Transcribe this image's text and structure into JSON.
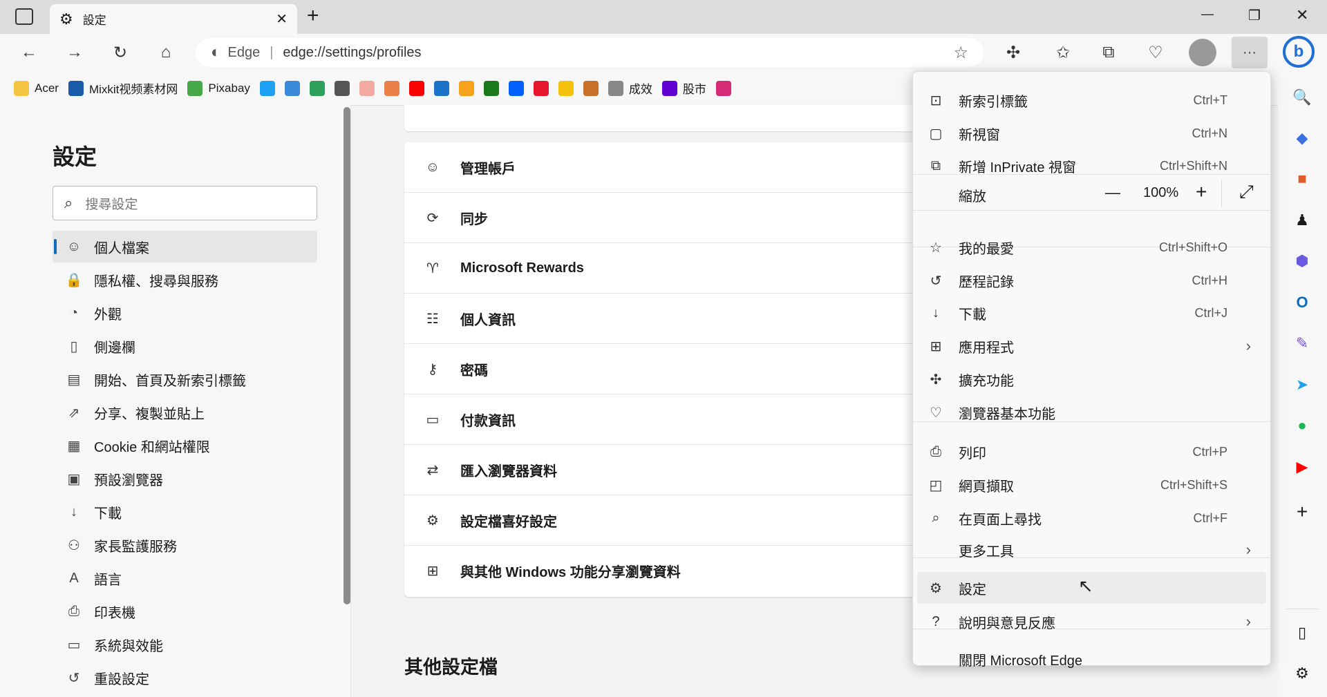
{
  "tab": {
    "title": "設定",
    "close": "✕",
    "new_tab": "+"
  },
  "window": {
    "minimize": "—",
    "restore": "❐",
    "close": "✕"
  },
  "address": {
    "brand": "Edge",
    "url": "edge://settings/profiles"
  },
  "bookmarks": [
    {
      "label": "Acer",
      "color": "#f5c542"
    },
    {
      "label": "Mixkit视频素材网",
      "color": "#1a5aa8"
    },
    {
      "label": "Pixabay",
      "color": "#48a948"
    },
    {
      "label": "",
      "color": "#1ea1f2"
    },
    {
      "label": "",
      "color": "#3b8ad9"
    },
    {
      "label": "",
      "color": "#2ea05a"
    },
    {
      "label": "",
      "color": "#555"
    },
    {
      "label": "",
      "color": "#f1a9a0"
    },
    {
      "label": "",
      "color": "#e9804a"
    },
    {
      "label": "",
      "color": "#ff0000"
    },
    {
      "label": "",
      "color": "#1a73c8"
    },
    {
      "label": "",
      "color": "#f7a21b"
    },
    {
      "label": "",
      "color": "#1a7a1a"
    },
    {
      "label": "",
      "color": "#0061fe"
    },
    {
      "label": "",
      "color": "#e6162d"
    },
    {
      "label": "",
      "color": "#f4c20d"
    },
    {
      "label": "",
      "color": "#c8702a"
    },
    {
      "label": "成效",
      "color": "#888"
    },
    {
      "label": "股市",
      "color": "#6001d2"
    },
    {
      "label": "",
      "color": "#d62976"
    }
  ],
  "settings": {
    "title": "設定",
    "search_placeholder": "搜尋設定",
    "nav": [
      {
        "label": "個人檔案",
        "icon": "profile-icon",
        "glyph": "☺",
        "selected": true
      },
      {
        "label": "隱私權、搜尋與服務",
        "icon": "lock-icon",
        "glyph": "🔒"
      },
      {
        "label": "外觀",
        "icon": "palette-icon",
        "glyph": "◔"
      },
      {
        "label": "側邊欄",
        "icon": "sidebar-icon",
        "glyph": "▯"
      },
      {
        "label": "開始、首頁及新索引標籤",
        "icon": "home-tab-icon",
        "glyph": "▤"
      },
      {
        "label": "分享、複製並貼上",
        "icon": "share-icon",
        "glyph": "⇗"
      },
      {
        "label": "Cookie 和網站權限",
        "icon": "site-permissions-icon",
        "glyph": "▦"
      },
      {
        "label": "預設瀏覽器",
        "icon": "default-browser-icon",
        "glyph": "▣"
      },
      {
        "label": "下載",
        "icon": "download-icon",
        "glyph": "↓"
      },
      {
        "label": "家長監護服務",
        "icon": "family-icon",
        "glyph": "⚇"
      },
      {
        "label": "語言",
        "icon": "language-icon",
        "glyph": "A"
      },
      {
        "label": "印表機",
        "icon": "printer-icon",
        "glyph": "⎙"
      },
      {
        "label": "系統與效能",
        "icon": "system-icon",
        "glyph": "▭"
      },
      {
        "label": "重設設定",
        "icon": "reset-icon",
        "glyph": "↺"
      }
    ],
    "profile_rows": [
      {
        "label": "管理帳戶",
        "icon": "account-icon",
        "glyph": "☺"
      },
      {
        "label": "同步",
        "icon": "sync-icon",
        "glyph": "⟳"
      },
      {
        "label": "Microsoft Rewards",
        "icon": "rewards-icon",
        "glyph": "♈"
      },
      {
        "label": "個人資訊",
        "icon": "personal-info-icon",
        "glyph": "☷"
      },
      {
        "label": "密碼",
        "icon": "key-icon",
        "glyph": "⚷"
      },
      {
        "label": "付款資訊",
        "icon": "card-icon",
        "glyph": "▭"
      },
      {
        "label": "匯入瀏覽器資料",
        "icon": "import-icon",
        "glyph": "⇄"
      },
      {
        "label": "設定檔喜好設定",
        "icon": "profile-prefs-icon",
        "glyph": "⚙"
      },
      {
        "label": "與其他 Windows 功能分享瀏覽資料",
        "icon": "windows-icon",
        "glyph": "⊞"
      }
    ],
    "other_profiles": "其他設定檔"
  },
  "menu": {
    "items": [
      {
        "label": "新索引標籤",
        "shortcut": "Ctrl+T",
        "icon": "new-tab-icon",
        "glyph": "⊡"
      },
      {
        "label": "新視窗",
        "shortcut": "Ctrl+N",
        "icon": "new-window-icon",
        "glyph": "▢"
      },
      {
        "label": "新增 InPrivate 視窗",
        "shortcut": "Ctrl+Shift+N",
        "icon": "inprivate-icon",
        "glyph": "⧉"
      },
      {
        "label": "我的最愛",
        "shortcut": "Ctrl+Shift+O",
        "icon": "favorites-icon",
        "glyph": "☆"
      },
      {
        "label": "歷程記錄",
        "shortcut": "Ctrl+H",
        "icon": "history-icon",
        "glyph": "↺"
      },
      {
        "label": "下載",
        "shortcut": "Ctrl+J",
        "icon": "download-icon",
        "glyph": "↓"
      },
      {
        "label": "應用程式",
        "shortcut": "",
        "icon": "apps-icon",
        "glyph": "⊞",
        "submenu": true
      },
      {
        "label": "擴充功能",
        "shortcut": "",
        "icon": "extensions-icon",
        "glyph": "✣"
      },
      {
        "label": "瀏覽器基本功能",
        "shortcut": "",
        "icon": "essentials-icon",
        "glyph": "♡"
      },
      {
        "label": "列印",
        "shortcut": "Ctrl+P",
        "icon": "print-icon",
        "glyph": "⎙"
      },
      {
        "label": "網頁擷取",
        "shortcut": "Ctrl+Shift+S",
        "icon": "capture-icon",
        "glyph": "◰"
      },
      {
        "label": "在頁面上尋找",
        "shortcut": "Ctrl+F",
        "icon": "find-icon",
        "glyph": "⌕"
      },
      {
        "label": "更多工具",
        "shortcut": "",
        "icon": "",
        "glyph": "",
        "submenu": true
      },
      {
        "label": "設定",
        "shortcut": "",
        "icon": "settings-icon",
        "glyph": "⚙",
        "highlighted": true
      },
      {
        "label": "說明與意見反應",
        "shortcut": "",
        "icon": "help-icon",
        "glyph": "?",
        "submenu": true
      },
      {
        "label": "關閉 Microsoft Edge",
        "shortcut": "",
        "icon": "",
        "glyph": ""
      }
    ],
    "zoom": {
      "label": "縮放",
      "value": "100%",
      "minus": "—",
      "plus": "+",
      "fullscreen": "⤢"
    }
  },
  "sidebar_colors": {
    "bing": "#1f6fd6",
    "accent": "#0f6cbd"
  }
}
